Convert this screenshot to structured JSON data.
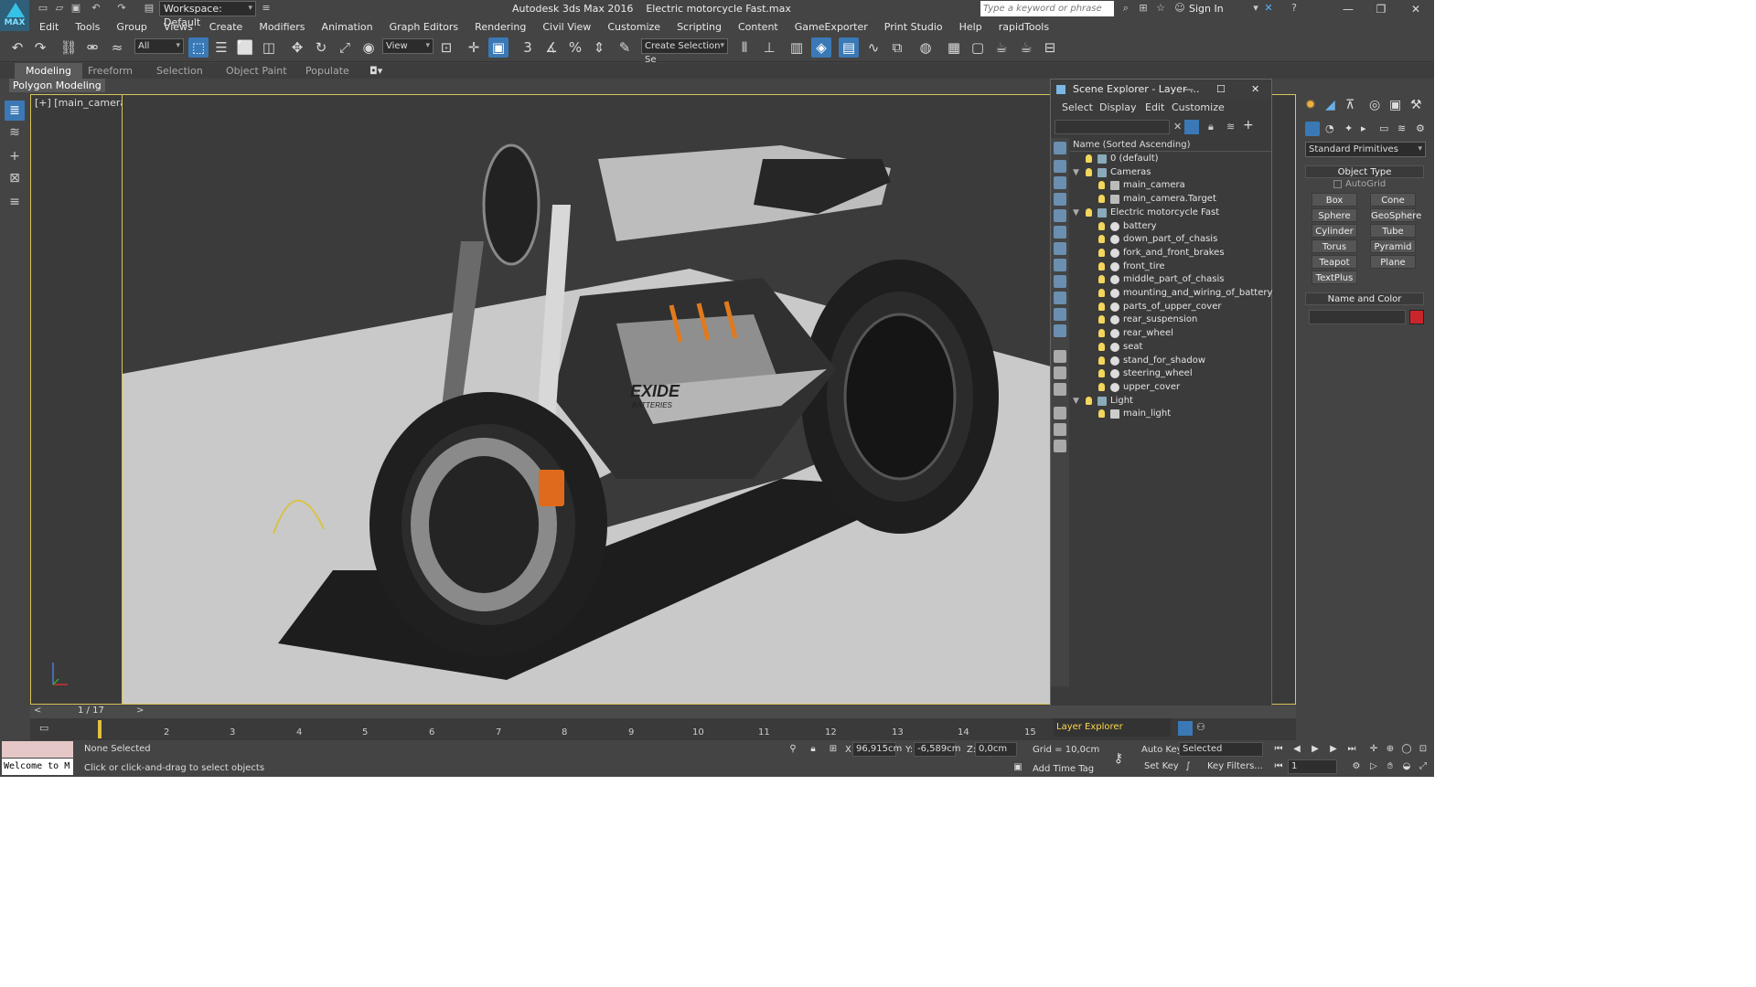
{
  "titlebar": {
    "app_title": "Autodesk 3ds Max 2016",
    "file": "Electric motorcycle Fast.max",
    "workspace": "Workspace: Default",
    "search_placeholder": "Type a keyword or phrase",
    "sign_in": "Sign In",
    "logo_text": "MAX"
  },
  "menu": [
    "Edit",
    "Tools",
    "Group",
    "Views",
    "Create",
    "Modifiers",
    "Animation",
    "Graph Editors",
    "Rendering",
    "Civil View",
    "Customize",
    "Scripting",
    "Content",
    "GameExporter",
    "Print Studio",
    "Help",
    "rapidTools"
  ],
  "toolbar": {
    "filter": "All",
    "ref_coord": "View",
    "selection_set": "Create Selection Se"
  },
  "ribbon": {
    "tabs": [
      "Modeling",
      "Freeform",
      "Selection",
      "Object Paint",
      "Populate"
    ],
    "active": "Modeling",
    "subtab": "Polygon Modeling"
  },
  "viewport": {
    "label": "[+] [main_camera ] [Realistic ]",
    "logo_text_1": "EXIDE",
    "logo_text_2": "BATTERIES"
  },
  "scene_explorer": {
    "title": "Scene Explorer - Layer ...",
    "menus": [
      "Select",
      "Display",
      "Edit",
      "Customize"
    ],
    "column": "Name (Sorted Ascending)",
    "footer": "Layer Explorer",
    "rows": [
      {
        "name": "0 (default)",
        "type": "layer",
        "level": 0
      },
      {
        "name": "Cameras",
        "type": "layer",
        "level": 0,
        "expanded": true
      },
      {
        "name": "main_camera",
        "type": "cam",
        "level": 1
      },
      {
        "name": "main_camera.Target",
        "type": "cam",
        "level": 1
      },
      {
        "name": "Electric motorcycle Fast",
        "type": "layer",
        "level": 0,
        "expanded": true
      },
      {
        "name": "battery",
        "type": "obj",
        "level": 1
      },
      {
        "name": "down_part_of_chasis",
        "type": "obj",
        "level": 1
      },
      {
        "name": "fork_and_front_brakes",
        "type": "obj",
        "level": 1
      },
      {
        "name": "front_tire",
        "type": "obj",
        "level": 1
      },
      {
        "name": "middle_part_of_chasis",
        "type": "obj",
        "level": 1
      },
      {
        "name": "mounting_and_wiring_of_battery",
        "type": "obj",
        "level": 1
      },
      {
        "name": "parts_of_upper_cover",
        "type": "obj",
        "level": 1
      },
      {
        "name": "rear_suspension",
        "type": "obj",
        "level": 1
      },
      {
        "name": "rear_wheel",
        "type": "obj",
        "level": 1
      },
      {
        "name": "seat",
        "type": "obj",
        "level": 1
      },
      {
        "name": "stand_for_shadow",
        "type": "obj",
        "level": 1
      },
      {
        "name": "steering_wheel",
        "type": "obj",
        "level": 1
      },
      {
        "name": "upper_cover",
        "type": "obj",
        "level": 1
      },
      {
        "name": "Light",
        "type": "layer",
        "level": 0,
        "expanded": true
      },
      {
        "name": "main_light",
        "type": "light",
        "level": 1
      }
    ]
  },
  "command_panel": {
    "category": "Standard Primitives",
    "object_type": "Object Type",
    "autogrid": "AutoGrid",
    "buttons": [
      "Box",
      "Cone",
      "Sphere",
      "GeoSphere",
      "Cylinder",
      "Tube",
      "Torus",
      "Pyramid",
      "Teapot",
      "Plane",
      "TextPlus"
    ],
    "name_and_color": "Name and Color",
    "color": "#c8262a"
  },
  "timeline": {
    "frame": "1 / 17",
    "ticks": [
      "2",
      "3",
      "4",
      "5",
      "6",
      "7",
      "8",
      "9",
      "10",
      "11",
      "12",
      "13",
      "14",
      "15"
    ]
  },
  "status": {
    "listener": "Welcome to M",
    "selection": "None Selected",
    "prompt": "Click or click-and-drag to select objects",
    "x_label": "X:",
    "x": "96,915cm",
    "y_label": "Y:",
    "y": "-6,589cm",
    "z_label": "Z:",
    "z": "0,0cm",
    "grid": "Grid = 10,0cm",
    "add_time_tag": "Add Time Tag",
    "auto_key": "Auto Key",
    "set_key": "Set Key",
    "key_mode": "Selected",
    "key_filters": "Key Filters...",
    "current_frame": "1"
  }
}
